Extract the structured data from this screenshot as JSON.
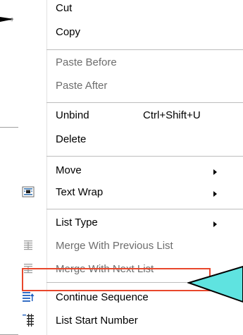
{
  "menu": {
    "items": [
      {
        "label": "Cut",
        "enabled": true
      },
      {
        "label": "Copy",
        "enabled": true
      },
      {
        "label": "Paste Before",
        "enabled": false
      },
      {
        "label": "Paste After",
        "enabled": false
      },
      {
        "label": "Unbind",
        "shortcut": "Ctrl+Shift+U",
        "enabled": true
      },
      {
        "label": "Delete",
        "enabled": true
      },
      {
        "label": "Move",
        "enabled": true,
        "submenu": true
      },
      {
        "label": "Text Wrap",
        "enabled": true,
        "submenu": true,
        "icon": "text-wrap-icon"
      },
      {
        "label": "List Type",
        "enabled": true,
        "submenu": true
      },
      {
        "label": "Merge With Previous List",
        "enabled": false,
        "icon": "merge-previous-icon"
      },
      {
        "label": "Merge With Next List",
        "enabled": false,
        "icon": "merge-next-icon"
      },
      {
        "label": "Continue Sequence",
        "enabled": true,
        "highlighted": true,
        "icon": "continue-sequence-icon"
      },
      {
        "label": "List Start Number",
        "enabled": true,
        "icon": "list-start-number-icon"
      }
    ]
  },
  "annotation": {
    "highlight_color": "#e8472c",
    "callout_color": "#5fe3e0"
  }
}
